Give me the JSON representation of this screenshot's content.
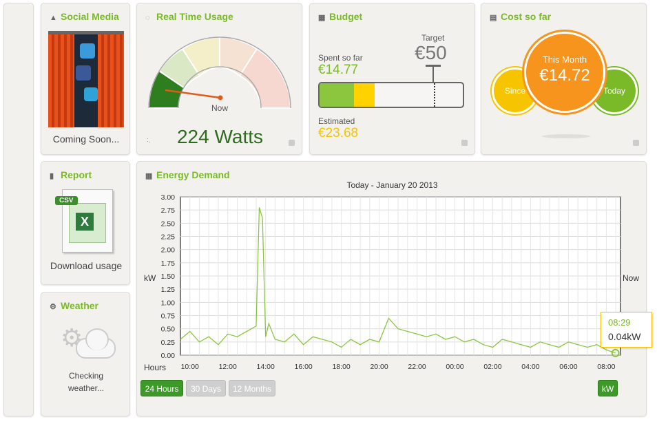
{
  "social": {
    "title": "Social Media",
    "status": "Coming Soon..."
  },
  "realtime": {
    "title": "Real Time Usage",
    "now_label": "Now",
    "value": "224 Watts",
    "level": 0.15
  },
  "budget": {
    "title": "Budget",
    "target_label": "Target",
    "target_value": "€50",
    "spent_label": "Spent so far",
    "spent_value": "€14.77",
    "estimated_label": "Estimated",
    "estimated_value": "€23.68"
  },
  "cost": {
    "title": "Cost so far",
    "this_month_label": "This Month",
    "this_month_value": "€14.72",
    "since_label": "Since",
    "today_label": "Today"
  },
  "report": {
    "title": "Report",
    "badge": "CSV",
    "download_label": "Download usage"
  },
  "weather": {
    "title": "Weather",
    "status": "Checking weather..."
  },
  "energy": {
    "title": "Energy Demand",
    "subtitle": "Today - January 20 2013",
    "ylabel": "kW",
    "xlabel": "Hours",
    "now_label": "Now",
    "tooltip_time": "08:29",
    "tooltip_value": "0.04kW"
  },
  "controls": {
    "range_24h": "24 Hours",
    "range_30d": "30 Days",
    "range_12m": "12 Months",
    "unit_btn": "kW"
  },
  "colors": {
    "accent": "#7ab928",
    "line": "#8cc63f",
    "gauge_low": "#2e7d1e",
    "bar_green": "#8cc63f",
    "bar_yellow": "#ffd200",
    "orange": "#f7941e"
  },
  "chart_data": {
    "type": "line",
    "title": "Today - January 20 2013",
    "xlabel": "Hours",
    "ylabel": "kW",
    "ylim": [
      0,
      3.0
    ],
    "yticks": [
      "0.00",
      "0.25",
      "0.50",
      "0.75",
      "1.00",
      "1.25",
      "1.50",
      "1.75",
      "2.00",
      "2.25",
      "2.50",
      "2.75",
      "3.00"
    ],
    "xticks": [
      "10:00",
      "12:00",
      "14:00",
      "16:00",
      "18:00",
      "20:00",
      "22:00",
      "00:00",
      "02:00",
      "04:00",
      "06:00",
      "08:00"
    ],
    "grid": true,
    "x": [
      "09:30",
      "10:00",
      "10:30",
      "11:00",
      "11:30",
      "12:00",
      "12:30",
      "13:00",
      "13:30",
      "13:40",
      "13:50",
      "14:00",
      "14:10",
      "14:30",
      "15:00",
      "15:30",
      "16:00",
      "16:30",
      "17:00",
      "17:30",
      "18:00",
      "18:30",
      "19:00",
      "19:30",
      "20:00",
      "20:30",
      "21:00",
      "21:30",
      "22:00",
      "22:30",
      "23:00",
      "23:30",
      "00:00",
      "00:30",
      "01:00",
      "01:30",
      "02:00",
      "02:30",
      "03:00",
      "03:30",
      "04:00",
      "04:30",
      "05:00",
      "05:30",
      "06:00",
      "06:30",
      "07:00",
      "07:30",
      "08:00",
      "08:29"
    ],
    "series": [
      {
        "values": [
          0.3,
          0.45,
          0.25,
          0.35,
          0.2,
          0.4,
          0.35,
          0.45,
          0.55,
          2.8,
          2.6,
          0.35,
          0.6,
          0.3,
          0.25,
          0.4,
          0.2,
          0.35,
          0.3,
          0.25,
          0.15,
          0.3,
          0.2,
          0.3,
          0.25,
          0.7,
          0.5,
          0.45,
          0.4,
          0.35,
          0.4,
          0.3,
          0.35,
          0.25,
          0.3,
          0.2,
          0.15,
          0.3,
          0.25,
          0.2,
          0.15,
          0.25,
          0.2,
          0.15,
          0.25,
          0.2,
          0.15,
          0.2,
          0.1,
          0.04
        ]
      }
    ]
  }
}
